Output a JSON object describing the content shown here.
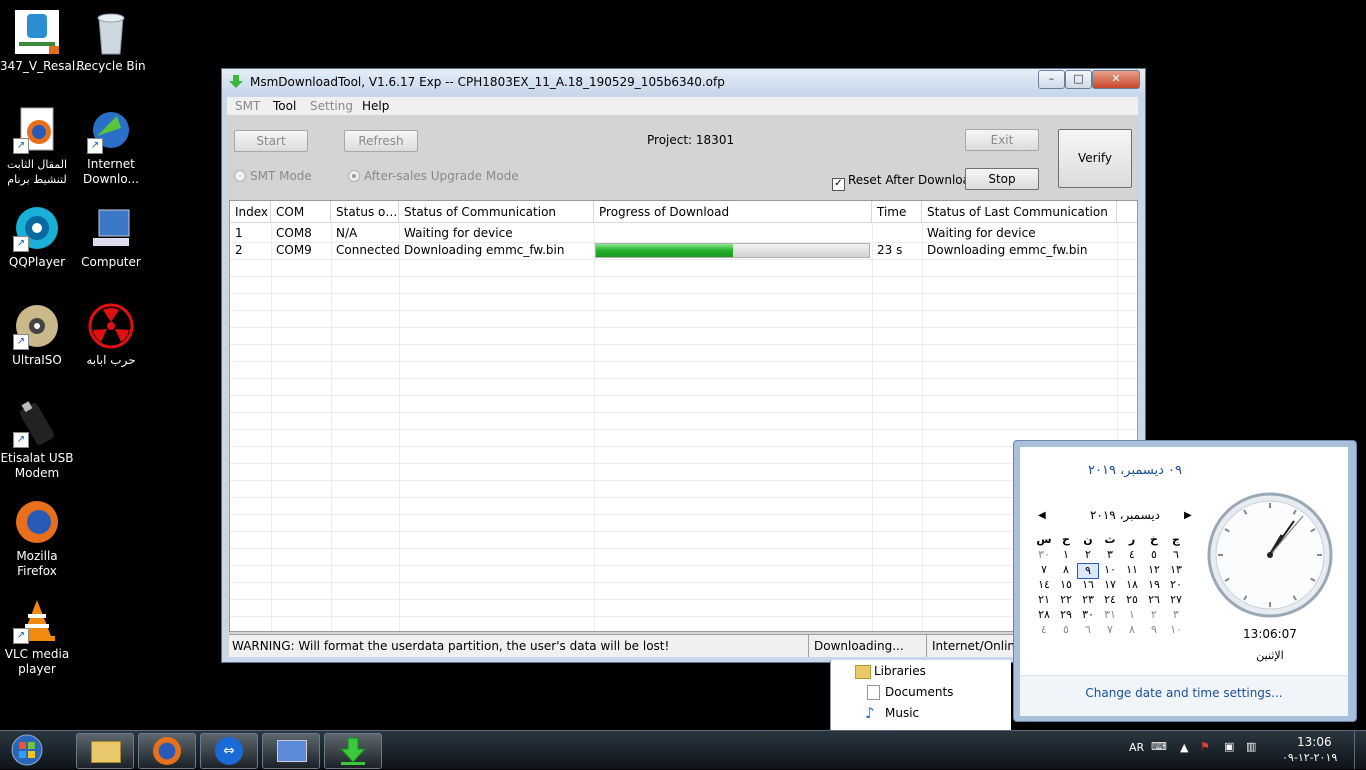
{
  "desktop": {
    "icons": [
      {
        "label": "347_V_Resal...",
        "name": "icon-347-v-resal"
      },
      {
        "label": "Recycle Bin",
        "name": "icon-recycle-bin"
      },
      {
        "label": "المقال الثابت لتنشيط برنام",
        "name": "icon-firefox-shortcut"
      },
      {
        "label": "Internet Downlo...",
        "name": "icon-internet-download-manager"
      },
      {
        "label": "QQPlayer",
        "name": "icon-qqplayer"
      },
      {
        "label": "Computer",
        "name": "icon-computer"
      },
      {
        "label": "UltraISO",
        "name": "icon-ultraiso"
      },
      {
        "label": "حرب ابابه",
        "name": "icon-radiation-folder"
      },
      {
        "label": "Etisalat USB Modem",
        "name": "icon-etisalat-modem"
      },
      {
        "label": "Mozilla Firefox",
        "name": "icon-mozilla-firefox"
      },
      {
        "label": "VLC media player",
        "name": "icon-vlc"
      }
    ]
  },
  "window": {
    "title": "MsmDownloadTool, V1.6.17 Exp -- CPH1803EX_11_A.18_190529_105b6340.ofp",
    "menu": {
      "smt": "SMT",
      "tool": "Tool",
      "setting": "Setting",
      "help": "Help"
    },
    "buttons": {
      "start": "Start",
      "refresh": "Refresh",
      "exit": "Exit",
      "stop": "Stop",
      "verify": "Verify"
    },
    "project_label": "Project: 18301",
    "modes": {
      "smt": "SMT Mode",
      "after_sales": "After-sales Upgrade Mode"
    },
    "reset_after_download": {
      "label": "Reset After Download",
      "checked": true
    },
    "table": {
      "headers": [
        "Index",
        "COM",
        "Status of...",
        "Status of Communication",
        "Progress of Download",
        "Time",
        "Status of Last Communication"
      ],
      "rows": [
        {
          "index": "1",
          "com": "COM8",
          "status": "N/A",
          "comm": "Waiting for device",
          "progress": 0,
          "time": "",
          "last": "Waiting for device"
        },
        {
          "index": "2",
          "com": "COM9",
          "status": "Connected",
          "comm": "Downloading emmc_fw.bin",
          "progress": 0.5,
          "time": "23 s",
          "last": "Downloading emmc_fw.bin"
        }
      ]
    },
    "status": {
      "warning": "WARNING: Will format the userdata partition, the user's data will be lost!",
      "state": "Downloading...",
      "net": "Internet/Online"
    }
  },
  "explorer": {
    "libraries": "Libraries",
    "documents": "Documents",
    "music": "Music"
  },
  "calendar": {
    "full_date": "٠٩ ديسمبر، ٢٠١٩",
    "month_year": "ديسمبر، ٢٠١٩",
    "weekdays": [
      "ج",
      "خ",
      "ر",
      "ث",
      "ن",
      "ح",
      "س"
    ],
    "weeks": [
      [
        "٦",
        "٥",
        "٤",
        "٣",
        "٢",
        "١",
        "٣٠"
      ],
      [
        "١٣",
        "١٢",
        "١١",
        "١٠",
        "٩",
        "٨",
        "٧"
      ],
      [
        "٢٠",
        "١٩",
        "١٨",
        "١٧",
        "١٦",
        "١٥",
        "١٤"
      ],
      [
        "٢٧",
        "٢٦",
        "٢٥",
        "٢٤",
        "٢٣",
        "٢٢",
        "٢١"
      ],
      [
        "٣",
        "٢",
        "١",
        "٣١",
        "٣٠",
        "٢٩",
        "٢٨"
      ],
      [
        "١٠",
        "٩",
        "٨",
        "٧",
        "٦",
        "٥",
        "٤"
      ]
    ],
    "time": "13:06:07",
    "day_name": "الإثنين",
    "change_link": "Change date and time settings..."
  },
  "taskbar": {
    "lang": "AR",
    "time": "13:06",
    "date": "٢٠١٩-١٢-٠٩"
  },
  "colors": {
    "progress": "#22b02a",
    "link": "#1a4f9c"
  }
}
